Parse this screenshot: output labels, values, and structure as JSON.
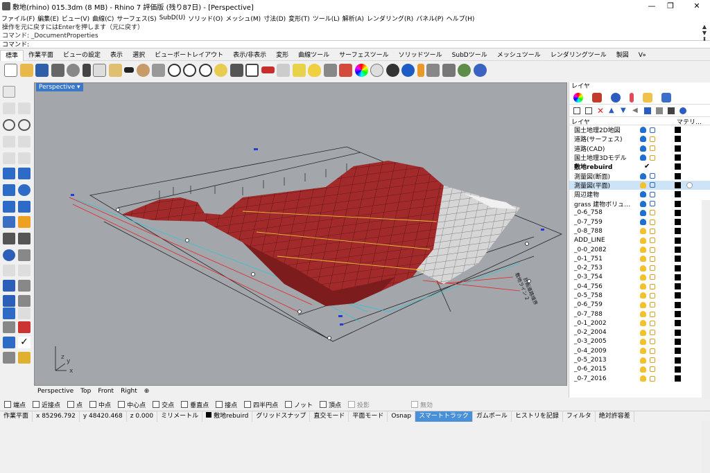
{
  "window": {
    "title": "敷地(rhino) 015.3dm (8 MB) - Rhino 7 評価版 (残り87日) - [Perspective]",
    "minimize": "—",
    "restore": "❐",
    "close": "✕"
  },
  "menu": [
    "ファイル(F)",
    "編集(E)",
    "ビュー(V)",
    "曲線(C)",
    "サーフェス(S)",
    "SubD(U)",
    "ソリッド(O)",
    "メッシュ(M)",
    "寸法(D)",
    "変形(T)",
    "ツール(L)",
    "解析(A)",
    "レンダリング(R)",
    "パネル(P)",
    "ヘルプ(H)"
  ],
  "command": {
    "history1": "操作を元に戻すにはEnterを押します（元に戻す）",
    "history2": "コマンド: _DocumentProperties",
    "prompt": "コマンド:"
  },
  "toolbar_tabs": [
    "標準",
    "作業平面",
    "ビューの設定",
    "表示",
    "選択",
    "ビューポートレイアウト",
    "表示/非表示",
    "変形",
    "曲線ツール",
    "サーフェスツール",
    "ソリッドツール",
    "SubDツール",
    "メッシュツール",
    "レンダリングツール",
    "製図",
    "V»"
  ],
  "viewport": {
    "name": "Perspective",
    "axis_y": "y",
    "axis_x": "x",
    "axis_z": "z",
    "tabs": [
      "Perspective",
      "Top",
      "Front",
      "Right"
    ],
    "annotation1": "敷地ライン 2",
    "annotation2": "計画道路境界"
  },
  "panel": {
    "title": "レイヤ",
    "col_layer": "レイヤ",
    "col_material": "マテリ…",
    "layers": [
      {
        "name": "国土地理2D地図",
        "bulb": "on",
        "lock": "locked"
      },
      {
        "name": "道路(サーフェス)",
        "bulb": "on",
        "lock": "unlocked"
      },
      {
        "name": "道路(CAD)",
        "bulb": "on",
        "lock": "unlocked"
      },
      {
        "name": "国土地理3Dモデル",
        "bulb": "on",
        "lock": "unlocked"
      },
      {
        "name": "敷地rebuird",
        "bulb": "current",
        "lock": ""
      },
      {
        "name": "測量図(断面)",
        "bulb": "on",
        "lock": "locked"
      },
      {
        "name": "測量図(平面)",
        "bulb": "off",
        "lock": "locked",
        "selected": true
      },
      {
        "name": "周辺建物",
        "bulb": "on",
        "lock": "locked"
      },
      {
        "name": "grass 建物ボリュ…",
        "bulb": "on",
        "lock": "locked"
      },
      {
        "name": "_0-6_758",
        "bulb": "on",
        "lock": "unlocked"
      },
      {
        "name": "_0-7_759",
        "bulb": "on",
        "lock": "unlocked"
      },
      {
        "name": "_0-8_788",
        "bulb": "off",
        "lock": "unlocked"
      },
      {
        "name": "ADD_LINE",
        "bulb": "off",
        "lock": "unlocked"
      },
      {
        "name": "_0-0_2082",
        "bulb": "off",
        "lock": "unlocked"
      },
      {
        "name": "_0-1_751",
        "bulb": "off",
        "lock": "unlocked"
      },
      {
        "name": "_0-2_753",
        "bulb": "off",
        "lock": "unlocked"
      },
      {
        "name": "_0-3_754",
        "bulb": "off",
        "lock": "unlocked"
      },
      {
        "name": "_0-4_756",
        "bulb": "off",
        "lock": "unlocked"
      },
      {
        "name": "_0-5_758",
        "bulb": "off",
        "lock": "unlocked"
      },
      {
        "name": "_0-6_759",
        "bulb": "off",
        "lock": "unlocked"
      },
      {
        "name": "_0-7_788",
        "bulb": "off",
        "lock": "unlocked"
      },
      {
        "name": "_0-1_2002",
        "bulb": "off",
        "lock": "unlocked"
      },
      {
        "name": "_0-2_2004",
        "bulb": "off",
        "lock": "unlocked"
      },
      {
        "name": "_0-3_2005",
        "bulb": "off",
        "lock": "unlocked"
      },
      {
        "name": "_0-4_2009",
        "bulb": "off",
        "lock": "unlocked"
      },
      {
        "name": "_0-5_2013",
        "bulb": "off",
        "lock": "unlocked"
      },
      {
        "name": "_0-6_2015",
        "bulb": "off",
        "lock": "unlocked"
      },
      {
        "name": "_0-7_2016",
        "bulb": "off",
        "lock": "unlocked"
      }
    ]
  },
  "osnap": [
    {
      "label": "端点",
      "checked": false
    },
    {
      "label": "近接点",
      "checked": false
    },
    {
      "label": "点",
      "checked": false
    },
    {
      "label": "中点",
      "checked": false
    },
    {
      "label": "中心点",
      "checked": false
    },
    {
      "label": "交点",
      "checked": false
    },
    {
      "label": "垂直点",
      "checked": false
    },
    {
      "label": "接点",
      "checked": false
    },
    {
      "label": "四半円点",
      "checked": false
    },
    {
      "label": "ノット",
      "checked": false
    },
    {
      "label": "頂点",
      "checked": false
    },
    {
      "label": "投影",
      "checked": false
    },
    {
      "label": "無効",
      "checked": false
    }
  ],
  "status": {
    "cplane": "作業平面",
    "x": "x 85296.792",
    "y": "y 48420.468",
    "z": "z 0.000",
    "units": "ミリメートル",
    "layer": "敷地rebuird",
    "grid_snap": "グリッドスナップ",
    "ortho": "直交モード",
    "planar": "平面モード",
    "osnap": "Osnap",
    "smarttrack": "スマートトラック",
    "gumball": "ガムボール",
    "history": "ヒストリを記録",
    "filter": "フィルタ",
    "tolerance": "絶対許容差"
  },
  "colors": {
    "viewport_bg": "#a3a7ac",
    "terrain": "#a32a2a",
    "terrain_grid": "#4a0f0f",
    "road_mesh": "#d9d9d9",
    "accent": "#3b78c8"
  }
}
